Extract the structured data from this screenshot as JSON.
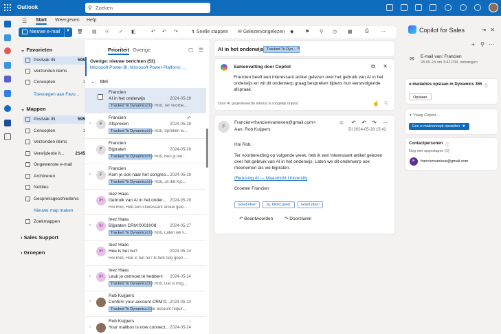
{
  "app": {
    "title": "Outlook"
  },
  "search": {
    "placeholder": "Zoeken"
  },
  "ribbon_tabs": [
    "Start",
    "Weergeven",
    "Help"
  ],
  "ribbon": {
    "new_mail": "Nieuwe e-mail",
    "quick_steps": "Snelle stappen",
    "read_unread": "Gelezen/ongelezen"
  },
  "folders": {
    "favorites_title": "Favorieten",
    "favorites": [
      {
        "label": "Postvak IN",
        "count": "595"
      },
      {
        "label": "Verzonden items",
        "count": ""
      },
      {
        "label": "Concepten",
        "count": "1"
      }
    ],
    "add_favorite": "Toevoegen aan Favo...",
    "folders_title": "Mappen",
    "items": [
      {
        "label": "Postvak IN",
        "count": "595"
      },
      {
        "label": "Concepten",
        "count": "1"
      },
      {
        "label": "Verzonden items",
        "count": ""
      },
      {
        "label": "Verwijderde it...",
        "count": "2145"
      },
      {
        "label": "Ongewenste e-mail",
        "count": ""
      },
      {
        "label": "Archiveren",
        "count": ""
      },
      {
        "label": "Notities",
        "count": ""
      },
      {
        "label": "Gespreksgeschiedenis",
        "count": ""
      }
    ],
    "new_folder": "Nieuwe map maken",
    "search_folders": "Zoekmappen",
    "sales_support": "Sales Support",
    "groups": "Groepen"
  },
  "mail_list": {
    "tabs": [
      "Prioriteit",
      "Overige"
    ],
    "overige_line1": "Overige: nieuwe berichten (53)",
    "overige_line2": "Microsoft Power BI; Microsoft Power Platform; ...",
    "group": "Mei",
    "messages": [
      {
        "from": "Francien",
        "subject": "AI in het onderwijs",
        "date": "2024-05-28",
        "tag": "Tracked To Dynamics...",
        "preview": "Hoi Rob, Ter voorbe...",
        "initials": "",
        "color": ""
      },
      {
        "from": "Francien",
        "subject": "Afspreken",
        "date": "2024-05-28",
        "tag": "Tracked To Dynamics...",
        "preview": "Hoi Rob, Spreken w...",
        "initials": "F",
        "color": "#e0dede"
      },
      {
        "from": "Francien",
        "subject": "Bijpraten",
        "date": "2024-05-28",
        "tag": "Tracked To Dynamics...",
        "preview": "Hoi Rob, Ben jij toe...",
        "initials": "F",
        "color": "#e0dede"
      },
      {
        "from": "Francien",
        "subject": "Kom je ook naar het congres...",
        "date": "2024-05-28",
        "tag": "Tracked To Dynamics...",
        "preview": "Hoi Rob, Ja dat kijt...",
        "initials": "F",
        "color": "#e0dede"
      },
      {
        "from": "Inez Haas",
        "subject": "Gebruik van AI in het onder...",
        "date": "2024-05-28",
        "tag": "",
        "preview": "Hoi Rob, Heb een interessant artikel gele...",
        "initials": "IH",
        "color": "#e6c3e6"
      },
      {
        "from": "Inez Haas",
        "subject": "Bijpraten CRM:0001008",
        "date": "2024-05-27",
        "tag": "Tracked To Dynamics...",
        "preview": "Hoi Rob, Laten we v...",
        "initials": "IH",
        "color": "#e6c3e6"
      },
      {
        "from": "Inez Haas",
        "subject": "Hoe is het nu?",
        "date": "2024-05-24",
        "tag": "",
        "preview": "Hoi Rob, Hoe is het nu? Ik heb nog geen ...",
        "initials": "IH",
        "color": "#e6c3e6"
      },
      {
        "from": "Inez Haas",
        "subject": "Leuk je ontmoet te hebben!",
        "date": "2024-05-24",
        "tag": "Tracked To Dynamics...",
        "preview": "Hoi Rob, Dat is insg...",
        "initials": "IH",
        "color": "#e6c3e6"
      },
      {
        "from": "Rob Kuijpers",
        "subject": "Confirm your account CRM:0...",
        "date": "2024-05-24",
        "tag": "Tracked To Dynamics...",
        "preview": "Your account requir...",
        "initials": "",
        "color": "#8a6d5c"
      },
      {
        "from": "Rob Kuijpers",
        "subject": "Your mailbox is now connect...",
        "date": "2024-05-24",
        "tag": "",
        "preview": "",
        "initials": "",
        "color": "#8a6d5c"
      }
    ]
  },
  "reading": {
    "title": "AI in het onderwijs",
    "tag": "Tracked To Dyn...",
    "summary_title": "Samenvatting door Copilot",
    "summary_text": "Francien heeft een interessant artikel gelezen over het gebruik van AI in het onderwijs en wil dit onderwerp graag bespreken tijdens hun eerstvolgende afspraak.",
    "ai_disclaimer": "Door AI gegenereerde inhoud is mogelijk onjuist",
    "sender_initial": "F",
    "sender": "Francien<francienvanleven@gmail.com>",
    "to": "Aan:  Rob Kuijpers",
    "date": "Di 2024-05-28 15:42",
    "greeting": "Hoi Rob,",
    "body": "Ter voorbereiding op volgende week, heb ik een interessant artikel gelezen over het gebruik van AI in het onderwijs. Laten we dit onderwerp ook meenemen als we bijpraten.",
    "link": "(Re)using AI — Maastricht University",
    "closing": "Groeten Francien",
    "chips": [
      "Goed idee!",
      "Ja, klinkt goed.",
      "Goed plan!"
    ],
    "reply": "Beantwoorden",
    "forward": "Doorsturen"
  },
  "copilot": {
    "title": "Copilot for Sales",
    "email_from": "E-mail van: Francien",
    "email_date": "28-05-24 om 3:42 P.M. ontvangen",
    "save_title": "e-mailadres opslaan in Dynamics 365",
    "save_btn": "Opslaan",
    "ask": "Vraag Copilot...",
    "draft_btn": "Een e-mailconcept opstellen",
    "contacts_title": "Contactpersonen",
    "contacts_sub": "Nog niet opgeslagen (1)",
    "contact_initial": "F",
    "contact_email": "francienvanleve@gmail.com"
  }
}
